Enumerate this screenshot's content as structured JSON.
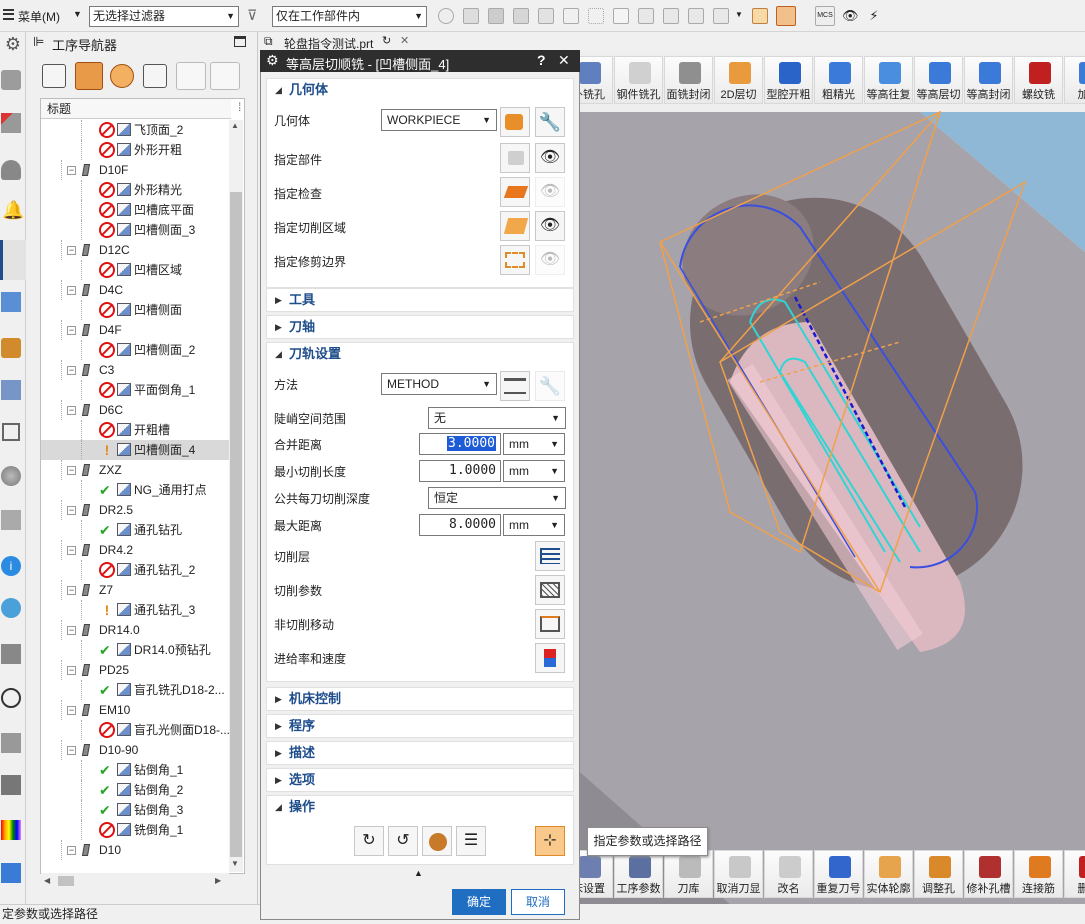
{
  "menu": {
    "label": "菜单(M)",
    "filter_value": "无选择过滤器",
    "scope_value": "仅在工作部件内"
  },
  "navigator": {
    "title": "工序导航器",
    "column_header": "标题",
    "rows": [
      {
        "label": "飞顶面_2",
        "level": 2,
        "status": "no"
      },
      {
        "label": "外形开粗",
        "level": 2,
        "status": "no"
      },
      {
        "label": "D10F",
        "level": 1,
        "status": "tool"
      },
      {
        "label": "外形精光",
        "level": 2,
        "status": "no"
      },
      {
        "label": "凹槽底平面",
        "level": 2,
        "status": "no"
      },
      {
        "label": "凹槽侧面_3",
        "level": 2,
        "status": "no"
      },
      {
        "label": "D12C",
        "level": 1,
        "status": "tool"
      },
      {
        "label": "凹槽区域",
        "level": 2,
        "status": "no"
      },
      {
        "label": "D4C",
        "level": 1,
        "status": "tool"
      },
      {
        "label": "凹槽侧面",
        "level": 2,
        "status": "no"
      },
      {
        "label": "D4F",
        "level": 1,
        "status": "tool"
      },
      {
        "label": "凹槽侧面_2",
        "level": 2,
        "status": "no"
      },
      {
        "label": "C3",
        "level": 1,
        "status": "tool"
      },
      {
        "label": "平面倒角_1",
        "level": 2,
        "status": "no"
      },
      {
        "label": "D6C",
        "level": 1,
        "status": "tool"
      },
      {
        "label": "开粗槽",
        "level": 2,
        "status": "no"
      },
      {
        "label": "凹槽侧面_4",
        "level": 2,
        "status": "warn"
      },
      {
        "label": "ZXZ",
        "level": 1,
        "status": "tool"
      },
      {
        "label": "NG_通用打点",
        "level": 2,
        "status": "ok"
      },
      {
        "label": "DR2.5",
        "level": 1,
        "status": "tool"
      },
      {
        "label": "通孔钻孔",
        "level": 2,
        "status": "ok"
      },
      {
        "label": "DR4.2",
        "level": 1,
        "status": "tool"
      },
      {
        "label": "通孔钻孔_2",
        "level": 2,
        "status": "no"
      },
      {
        "label": "Z7",
        "level": 1,
        "status": "tool"
      },
      {
        "label": "通孔钻孔_3",
        "level": 2,
        "status": "warn"
      },
      {
        "label": "DR14.0",
        "level": 1,
        "status": "tool"
      },
      {
        "label": "DR14.0预钻孔",
        "level": 2,
        "status": "ok"
      },
      {
        "label": "PD25",
        "level": 1,
        "status": "tool"
      },
      {
        "label": "盲孔铣孔D18-2...",
        "level": 2,
        "status": "ok"
      },
      {
        "label": "EM10",
        "level": 1,
        "status": "tool"
      },
      {
        "label": "盲孔光侧面D18-...",
        "level": 2,
        "status": "no"
      },
      {
        "label": "D10-90",
        "level": 1,
        "status": "tool"
      },
      {
        "label": "钻倒角_1",
        "level": 2,
        "status": "ok"
      },
      {
        "label": "钻倒角_2",
        "level": 2,
        "status": "ok"
      },
      {
        "label": "钻倒角_3",
        "level": 2,
        "status": "ok"
      },
      {
        "label": "铣倒角_1",
        "level": 2,
        "status": "no"
      },
      {
        "label": "D10",
        "level": 1,
        "status": "tool"
      }
    ]
  },
  "file_tab": "轮盘指令测试.prt",
  "dialog": {
    "title": "等高层切顺铣 - [凹槽侧面_4]",
    "help": "?",
    "close": "✕",
    "geometry": {
      "header": "几何体",
      "geom_label": "几何体",
      "geom_value": "WORKPIECE",
      "part": "指定部件",
      "check": "指定检查",
      "cut_area": "指定切削区域",
      "trim": "指定修剪边界"
    },
    "tool_header": "工具",
    "axis_header": "刀轴",
    "path": {
      "header": "刀轨设置",
      "method_label": "方法",
      "method_value": "METHOD",
      "steep_label": "陡峭空间范围",
      "steep_value": "无",
      "merge_label": "合并距离",
      "merge_value": "3.0000",
      "merge_unit": "mm",
      "minlen_label": "最小切削长度",
      "minlen_value": "1.0000",
      "minlen_unit": "mm",
      "depth_label": "公共每刀切削深度",
      "depth_value": "恒定",
      "maxdist_label": "最大距离",
      "maxdist_value": "8.0000",
      "maxdist_unit": "mm",
      "levels": "切削层",
      "params": "切削参数",
      "noncut": "非切削移动",
      "feeds": "进给率和速度"
    },
    "machine_header": "机床控制",
    "program_header": "程序",
    "desc_header": "描述",
    "options_header": "选项",
    "ops_header": "操作",
    "ok": "确定",
    "cancel": "取消"
  },
  "top_toolbar": [
    {
      "label": "外铣孔"
    },
    {
      "label": "钢件铣孔"
    },
    {
      "label": "面铣封闭"
    },
    {
      "label": "2D层切"
    },
    {
      "label": "型腔开粗"
    },
    {
      "label": "粗精光"
    },
    {
      "label": "等高往复"
    },
    {
      "label": "等高层切"
    },
    {
      "label": "等高封闭"
    },
    {
      "label": "螺纹铣"
    },
    {
      "label": "加工"
    }
  ],
  "bottom_toolbar": [
    {
      "label": "床设置"
    },
    {
      "label": "工序参数"
    },
    {
      "label": "刀库"
    },
    {
      "label": "取消刀显"
    },
    {
      "label": "改名"
    },
    {
      "label": "重复刀号"
    },
    {
      "label": "实体轮廓"
    },
    {
      "label": "调整孔"
    },
    {
      "label": "修补孔槽"
    },
    {
      "label": "连接筋"
    },
    {
      "label": "删除"
    }
  ],
  "tooltip": "指定参数或选择路径",
  "status_bar": "定参数或选择路径",
  "colors": {
    "accent": "#1e4d8c",
    "dialog_bg": "#2e2e2e",
    "viewport": "#a9a6ad",
    "toolpath": "#31d4d4",
    "selection": "#3a7bd5"
  }
}
